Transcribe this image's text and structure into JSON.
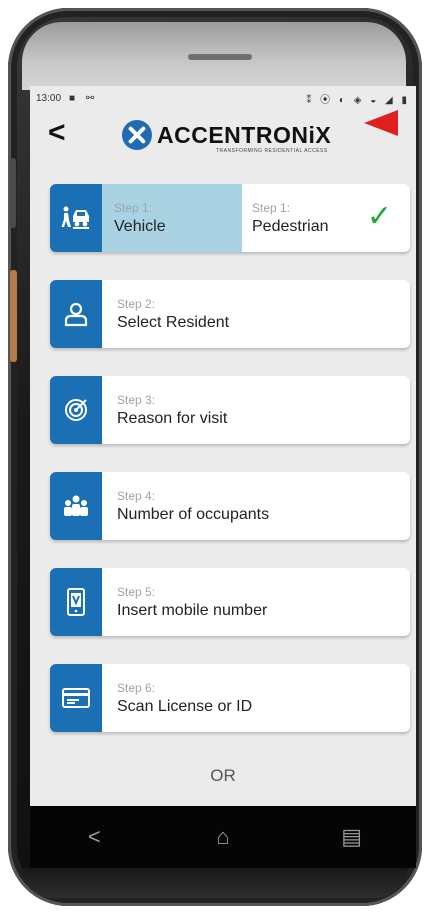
{
  "status_bar": {
    "time": "13:00",
    "left_icons": "■ ⚯",
    "right_icons": "⁑ ⦿ ◐ ◈ ◒ ◢ ▮"
  },
  "header": {
    "back_label": "<",
    "logo_text": "ACCENTRONiX",
    "logo_tagline": "TRANSFORMING RESIDENTIAL ACCESS",
    "brand_color": "#1a6fb5"
  },
  "steps": [
    {
      "sub_a": "Step 1:",
      "main_a": "Vehicle",
      "sub_b": "Step 1:",
      "main_b": "Pedestrian",
      "icon": "vehicle-pedestrian-icon",
      "checked": true
    },
    {
      "sub": "Step 2:",
      "main": "Select Resident",
      "icon": "person-icon"
    },
    {
      "sub": "Step 3:",
      "main": "Reason for visit",
      "icon": "target-icon"
    },
    {
      "sub": "Step 4:",
      "main": "Number of occupants",
      "icon": "group-icon"
    },
    {
      "sub": "Step 5:",
      "main": "Insert mobile number",
      "icon": "mobile-phone-icon"
    },
    {
      "sub": "Step 6:",
      "main": "Scan License or ID",
      "icon": "id-card-icon"
    }
  ],
  "or_label": "OR",
  "nav": {
    "back": "<",
    "home": "⌂",
    "recents": "▤"
  },
  "colors": {
    "selected_half": "#a9d3e2",
    "check": "#1fa834",
    "arrow": "#e02020"
  }
}
